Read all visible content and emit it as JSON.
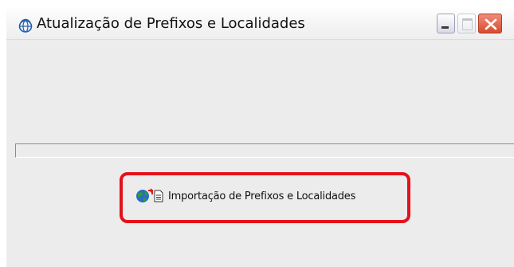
{
  "window": {
    "title": "Atualização de Prefixos e Localidades",
    "icon": "globe-app-icon"
  },
  "controls": {
    "minimize_icon": "minimize-icon",
    "maximize_icon": "maximize-icon",
    "close_icon": "close-icon"
  },
  "progress": {
    "value": 0
  },
  "import_button": {
    "label": "Importação de  Prefixos e Localidades",
    "icons": [
      "globe-icon",
      "document-icon"
    ]
  },
  "colors": {
    "highlight": "#e4121a",
    "close_button": "#d84b2e",
    "window_background": "#ececec"
  }
}
